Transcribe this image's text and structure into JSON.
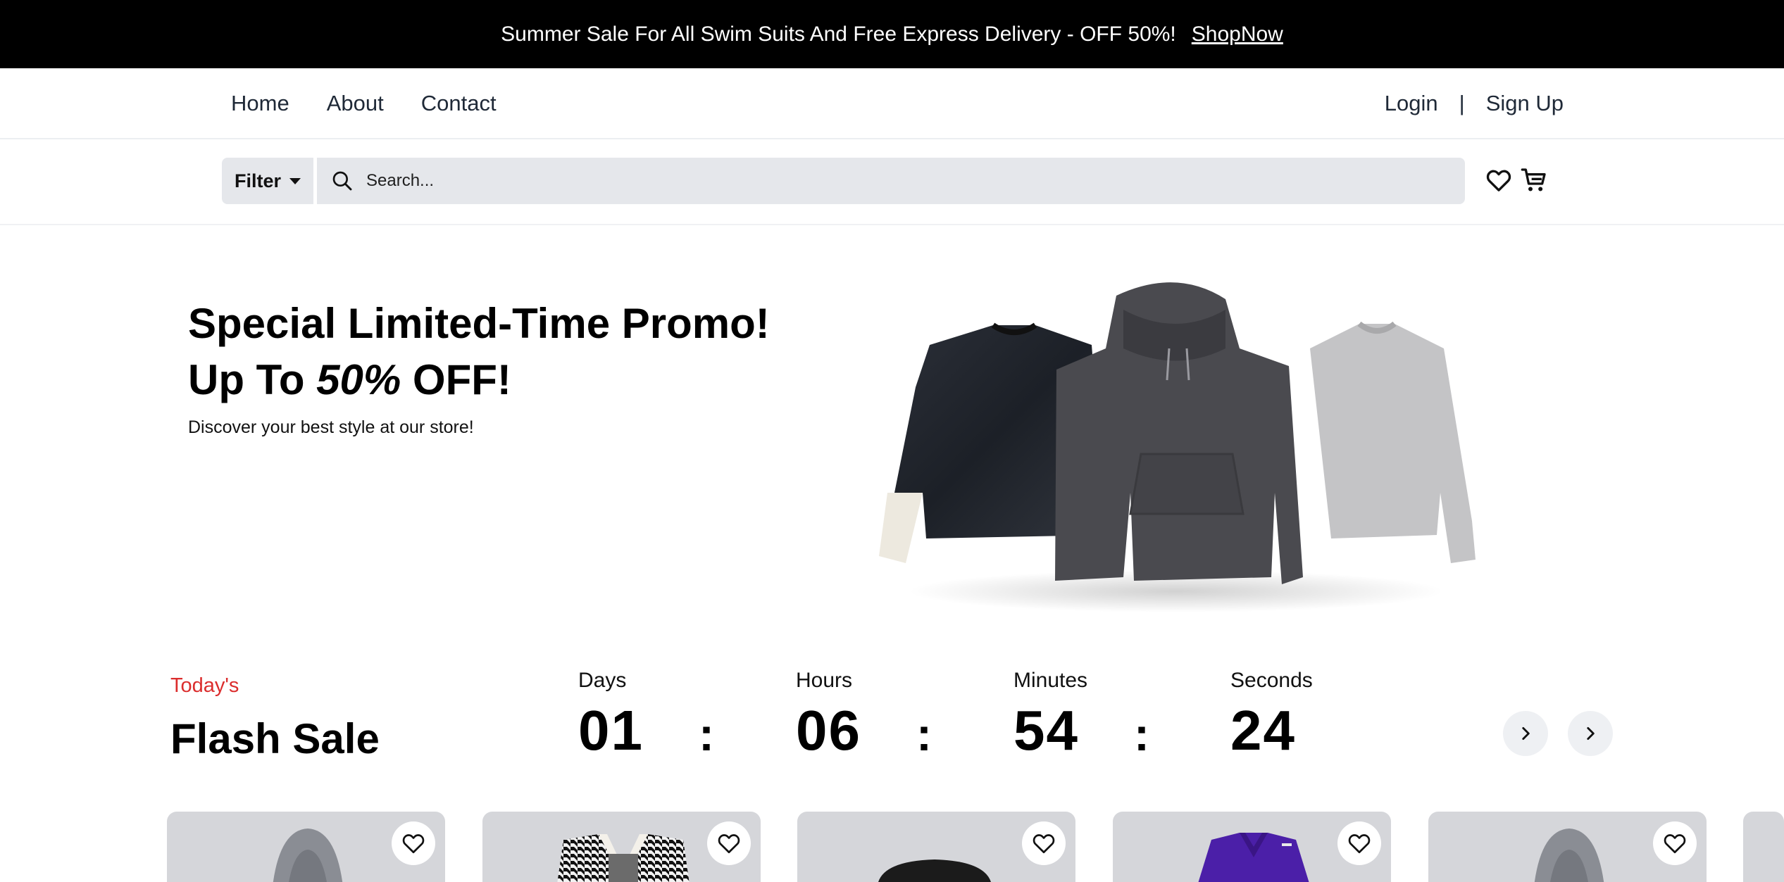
{
  "banner": {
    "text": "Summer Sale For All Swim Suits And Free Express Delivery - OFF 50%!",
    "link": "ShopNow"
  },
  "nav": {
    "links": [
      "Home",
      "About",
      "Contact"
    ],
    "login": "Login",
    "separator": "|",
    "signup": "Sign Up"
  },
  "search": {
    "filter_label": "Filter",
    "placeholder": "Search..."
  },
  "hero": {
    "title_line1": "Special Limited-Time Promo!",
    "title_line2_prefix": "Up To ",
    "title_line2_emph": "50%",
    "title_line2_suffix": " OFF!",
    "subtitle": "Discover your best style at our store!"
  },
  "flash_sale": {
    "eyebrow": "Today's",
    "title": "Flash Sale",
    "countdown": [
      {
        "label": "Days",
        "value": "01"
      },
      {
        "label": "Hours",
        "value": "06"
      },
      {
        "label": "Minutes",
        "value": "54"
      },
      {
        "label": "Seconds",
        "value": "24"
      }
    ],
    "separator": ":"
  },
  "icons": {
    "search": "search-icon",
    "wishlist": "heart-icon",
    "cart": "cart-icon",
    "filter_caret": "caret-down-icon",
    "next": "chevron-right-icon"
  },
  "colors": {
    "banner_bg": "#000000",
    "accent_red": "#db2d2d",
    "search_bg": "#e5e7eb",
    "card_bg": "#d5d6da"
  },
  "products": [
    {
      "image": "grey-hoodie"
    },
    {
      "image": "houndstooth-vest"
    },
    {
      "image": "black-shorts"
    },
    {
      "image": "purple-shirt"
    },
    {
      "image": "grey-hoodie"
    }
  ]
}
